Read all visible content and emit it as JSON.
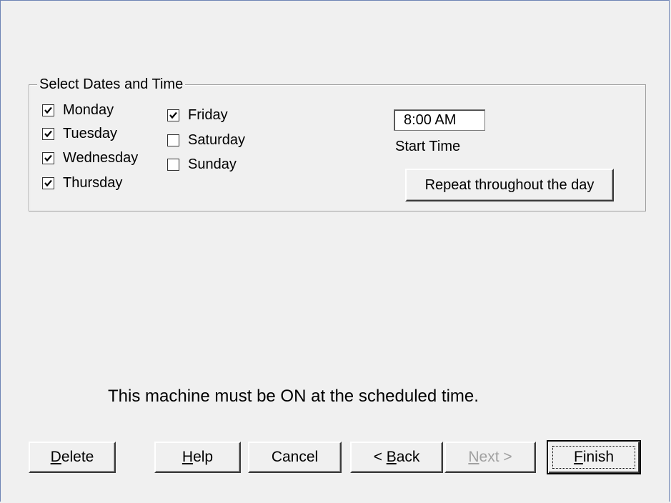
{
  "group": {
    "title": "Select Dates and Time"
  },
  "days": [
    {
      "label": "Monday",
      "checked": true
    },
    {
      "label": "Tuesday",
      "checked": true
    },
    {
      "label": "Wednesday",
      "checked": true
    },
    {
      "label": "Thursday",
      "checked": true
    },
    {
      "label": "Friday",
      "checked": true
    },
    {
      "label": "Saturday",
      "checked": false
    },
    {
      "label": "Sunday",
      "checked": false
    }
  ],
  "time": {
    "value": "8:00 AM",
    "caption": "Start Time"
  },
  "repeat_button": "Repeat throughout the day",
  "notice": "This machine must be ON at the scheduled time.",
  "buttons": {
    "delete": {
      "pre": "",
      "key": "D",
      "post": "elete"
    },
    "help": {
      "pre": "",
      "key": "H",
      "post": "elp"
    },
    "cancel": "Cancel",
    "back": {
      "pre": "< ",
      "key": "B",
      "post": "ack"
    },
    "next": {
      "pre": "",
      "key": "N",
      "post": "ext >"
    },
    "finish": {
      "pre": "",
      "key": "F",
      "post": "inish"
    }
  }
}
